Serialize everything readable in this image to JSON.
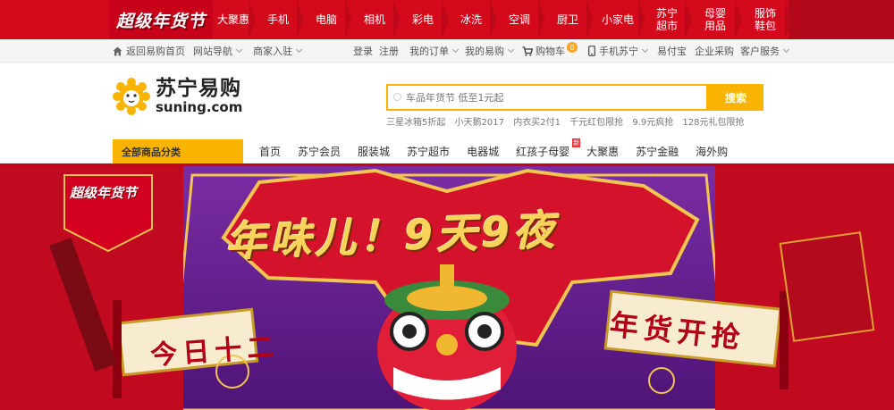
{
  "topbar": {
    "logo_text": "超级年货节",
    "items": [
      "大聚惠",
      "手机",
      "电脑",
      "相机",
      "彩电",
      "冰洗",
      "空调",
      "厨卫",
      "小家电",
      "苏宁\n超市",
      "母婴\n用品",
      "服饰\n鞋包"
    ]
  },
  "utilbar": {
    "home": "返回易购首页",
    "site_nav": "网站导航",
    "merchant": "商家入驻",
    "login": "登录",
    "register": "注册",
    "orders": "我的订单",
    "my_yigou": "我的易购",
    "cart": "购物车",
    "cart_count": "0",
    "mobile": "手机苏宁",
    "yifubao": "易付宝",
    "enterprise": "企业采购",
    "service": "客户服务"
  },
  "header": {
    "logo_cn": "苏宁易购",
    "logo_en": "suning.com",
    "search_placeholder": "车品年货节 低至1元起",
    "search_button": "搜索",
    "hotwords": [
      "三星冰箱5折起",
      "小天鹅2017",
      "内衣买2付1",
      "千元红包限抢",
      "9.9元疯抢",
      "128元礼包限抢"
    ]
  },
  "mainnav": {
    "all_categories": "全部商品分类",
    "items": [
      "首页",
      "苏宁会员",
      "服装城",
      "苏宁超市",
      "电器城",
      "红孩子母婴",
      "大聚惠",
      "苏宁金融",
      "海外购"
    ],
    "badge": "新"
  },
  "banner": {
    "badge": "超级年货节",
    "title": "年味儿！9天9夜",
    "left_scroll": "今日十二",
    "right_scroll": "年货开抢"
  },
  "colors": {
    "brand_red": "#d40a1c",
    "brand_yellow": "#f8b400"
  }
}
